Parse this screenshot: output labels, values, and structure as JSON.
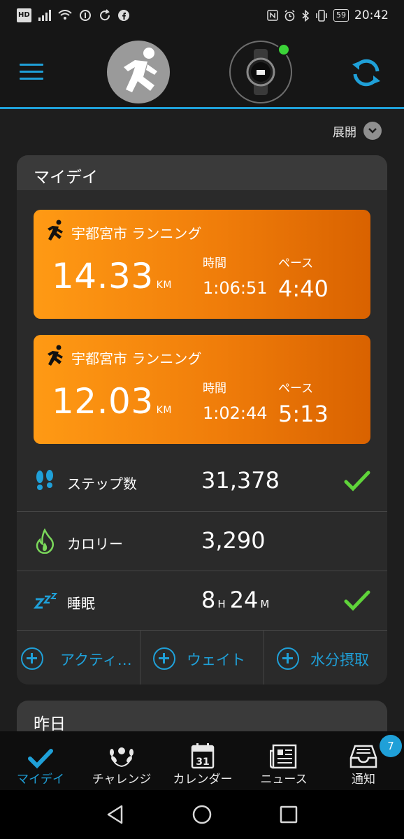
{
  "status_bar": {
    "left_icons": [
      "hd-icon",
      "signal-icon",
      "wifi-icon",
      "data-saver-icon",
      "sync-status-icon",
      "facebook-icon"
    ],
    "right_icons": [
      "nfc-icon",
      "alarm-icon",
      "bluetooth-icon",
      "vibrate-icon"
    ],
    "hd_label": "HD",
    "battery": "59",
    "time": "20:42"
  },
  "header": {
    "menu_icon": "hamburger-menu-icon",
    "profile_icon": "runner-avatar-icon",
    "device_icon": "watch-icon",
    "device_status_color": "#3bd338",
    "sync_icon": "sync-icon"
  },
  "expand_label": "展開",
  "my_day": {
    "title": "マイデイ",
    "activities": [
      {
        "name": "宇都宮市 ランニング",
        "distance": "14.33",
        "unit": "KM",
        "time_label": "時間",
        "time": "1:06:51",
        "pace_label": "ペース",
        "pace": "4:40"
      },
      {
        "name": "宇都宮市 ランニング",
        "distance": "12.03",
        "unit": "KM",
        "time_label": "時間",
        "time": "1:02:44",
        "pace_label": "ペース",
        "pace": "5:13"
      }
    ],
    "metrics": [
      {
        "icon": "footsteps-icon",
        "label": "ステップ数",
        "value": "31,378",
        "goal_met": true
      },
      {
        "icon": "flame-icon",
        "label": "カロリー",
        "value": "3,290",
        "goal_met": false
      },
      {
        "icon": "sleep-zzz-icon",
        "label": "睡眠",
        "hours": "8",
        "h_unit": "H",
        "minutes": "24",
        "m_unit": "M",
        "goal_met": true
      }
    ],
    "quick_add": [
      "アクティ…",
      "ウェイト",
      "水分摂取"
    ]
  },
  "yesterday": {
    "title": "昨日"
  },
  "bottom_nav": {
    "items": [
      {
        "label": "マイデイ",
        "icon": "check-icon",
        "active": true
      },
      {
        "label": "チャレンジ",
        "icon": "laurel-icon",
        "active": false
      },
      {
        "label": "カレンダー",
        "icon": "calendar-icon",
        "day": "31",
        "active": false
      },
      {
        "label": "ニュース",
        "icon": "newspaper-icon",
        "active": false
      },
      {
        "label": "通知",
        "icon": "inbox-icon",
        "active": false
      }
    ],
    "notification_count": "7"
  },
  "accent_color": "#1fa0d8",
  "activity_color": "#f58a0f",
  "goal_color": "#5fd33a"
}
